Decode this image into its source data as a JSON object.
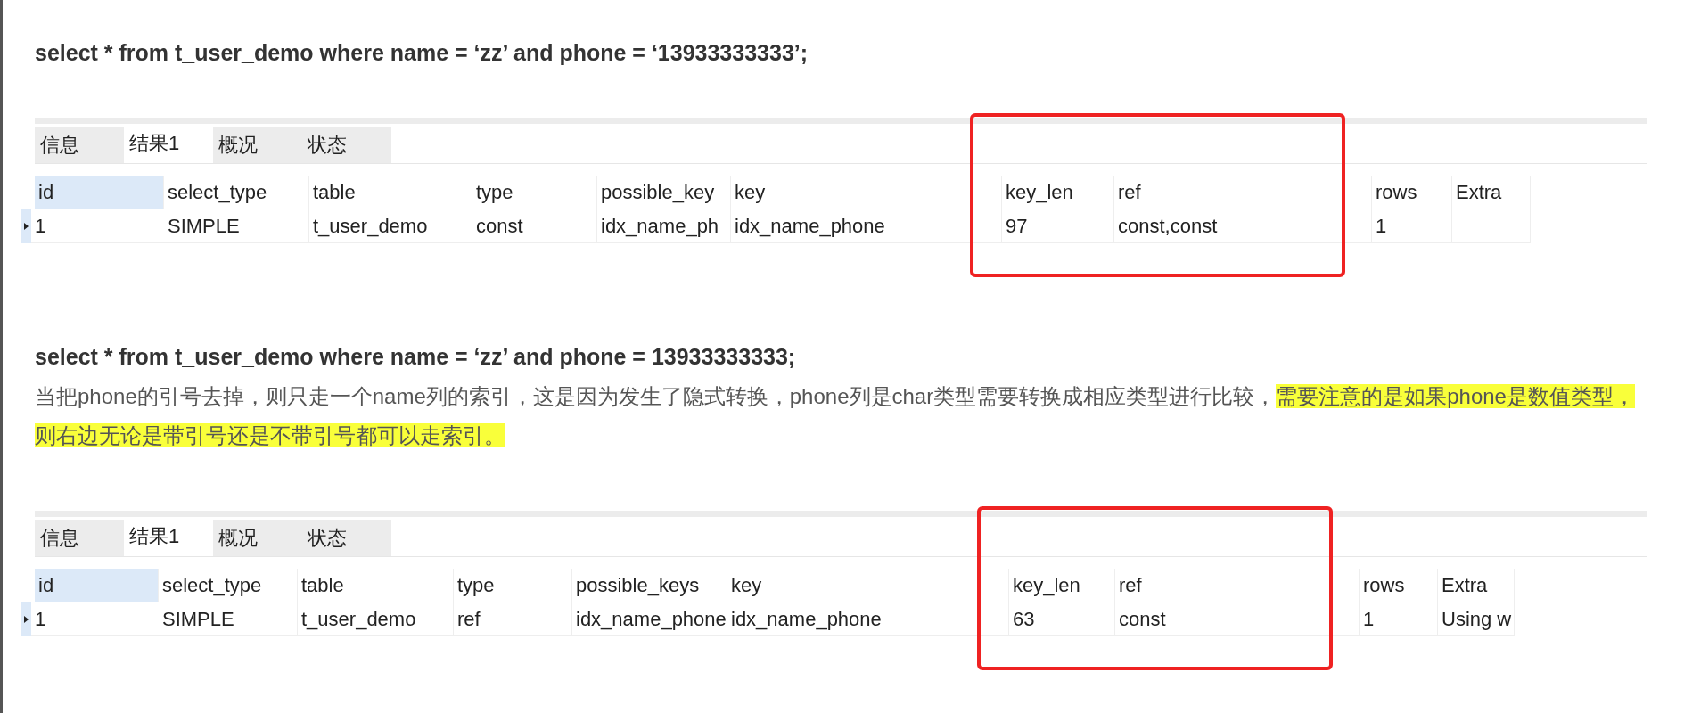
{
  "blocks": [
    {
      "kind": "query",
      "text": "select * from t_user_demo where name = ‘zz’ and phone = ‘13933333333’;"
    },
    {
      "kind": "result",
      "tabs": [
        {
          "label": "信息",
          "selected": false
        },
        {
          "label": "结果1",
          "selected": true
        },
        {
          "label": "概况",
          "selected": false
        },
        {
          "label": "状态",
          "selected": false
        }
      ],
      "column_groups": [
        {
          "highlighted": false,
          "columns": [
            "id",
            "select_type",
            "table",
            "type",
            "possible_key",
            "key"
          ]
        },
        {
          "highlighted": true,
          "columns": [
            "key_len",
            "ref"
          ]
        },
        {
          "highlighted": false,
          "columns": [
            "rows",
            "Extra"
          ]
        }
      ],
      "rows": [
        {
          "current": true,
          "cells": [
            "1",
            "SIMPLE",
            "t_user_demo",
            "const",
            "idx_name_ph",
            "idx_name_phone",
            "97",
            "const,const",
            "1",
            ""
          ]
        }
      ]
    },
    {
      "kind": "query",
      "text": "select * from t_user_demo where name = ‘zz’ and phone = 13933333333;"
    },
    {
      "kind": "note",
      "segments": [
        {
          "text": "当把phone的引号去掉，则只走一个name列的索引，这是因为发生了隐式转换，phone列是char类型需要转换成相应类型进行比较，",
          "highlighted": false
        },
        {
          "text": "需要注意的是如果phone是数值类型，则右边无论是带引号还是不带引号都可以走索引。",
          "highlighted": true
        }
      ]
    },
    {
      "kind": "result",
      "tabs": [
        {
          "label": "信息",
          "selected": false
        },
        {
          "label": "结果1",
          "selected": true
        },
        {
          "label": "概况",
          "selected": false
        },
        {
          "label": "状态",
          "selected": false
        }
      ],
      "column_groups": [
        {
          "highlighted": false,
          "columns": [
            "id",
            "select_type",
            "table",
            "type",
            "possible_keys",
            "key"
          ]
        },
        {
          "highlighted": true,
          "columns": [
            "key_len",
            "ref"
          ]
        },
        {
          "highlighted": false,
          "columns": [
            "rows",
            "Extra"
          ]
        }
      ],
      "rows": [
        {
          "current": true,
          "cells": [
            "1",
            "SIMPLE",
            "t_user_demo",
            "ref",
            "idx_name_phone",
            "idx_name_phone",
            "63",
            "const",
            "1",
            "Using w"
          ]
        }
      ]
    }
  ]
}
